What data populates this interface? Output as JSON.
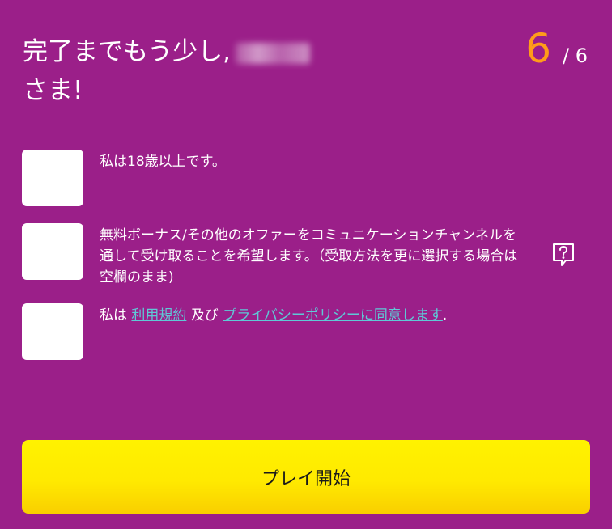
{
  "header": {
    "title_prefix": "完了までもう少し,",
    "title_suffix": "さま!",
    "step_current": "6",
    "step_total": "/ 6"
  },
  "checks": {
    "age": "私は18歳以上です。",
    "marketing": "無料ボーナス/その他のオファーをコミュニケーションチャンネルを通して受け取ることを希望します。（受取方法を更に選択する場合は空欄のまま)",
    "terms_prefix": "私は",
    "terms_link": "利用規約",
    "terms_middle": "及び",
    "privacy_link": "プライバシーポリシーに同意します",
    "terms_suffix": "."
  },
  "actions": {
    "play_label": "プレイ開始"
  },
  "colors": {
    "background": "#9b1f89",
    "accent": "#ff9c1a",
    "link": "#5fc9d6",
    "button": "#ffea00"
  },
  "icons": {
    "help": "help-question-icon"
  }
}
